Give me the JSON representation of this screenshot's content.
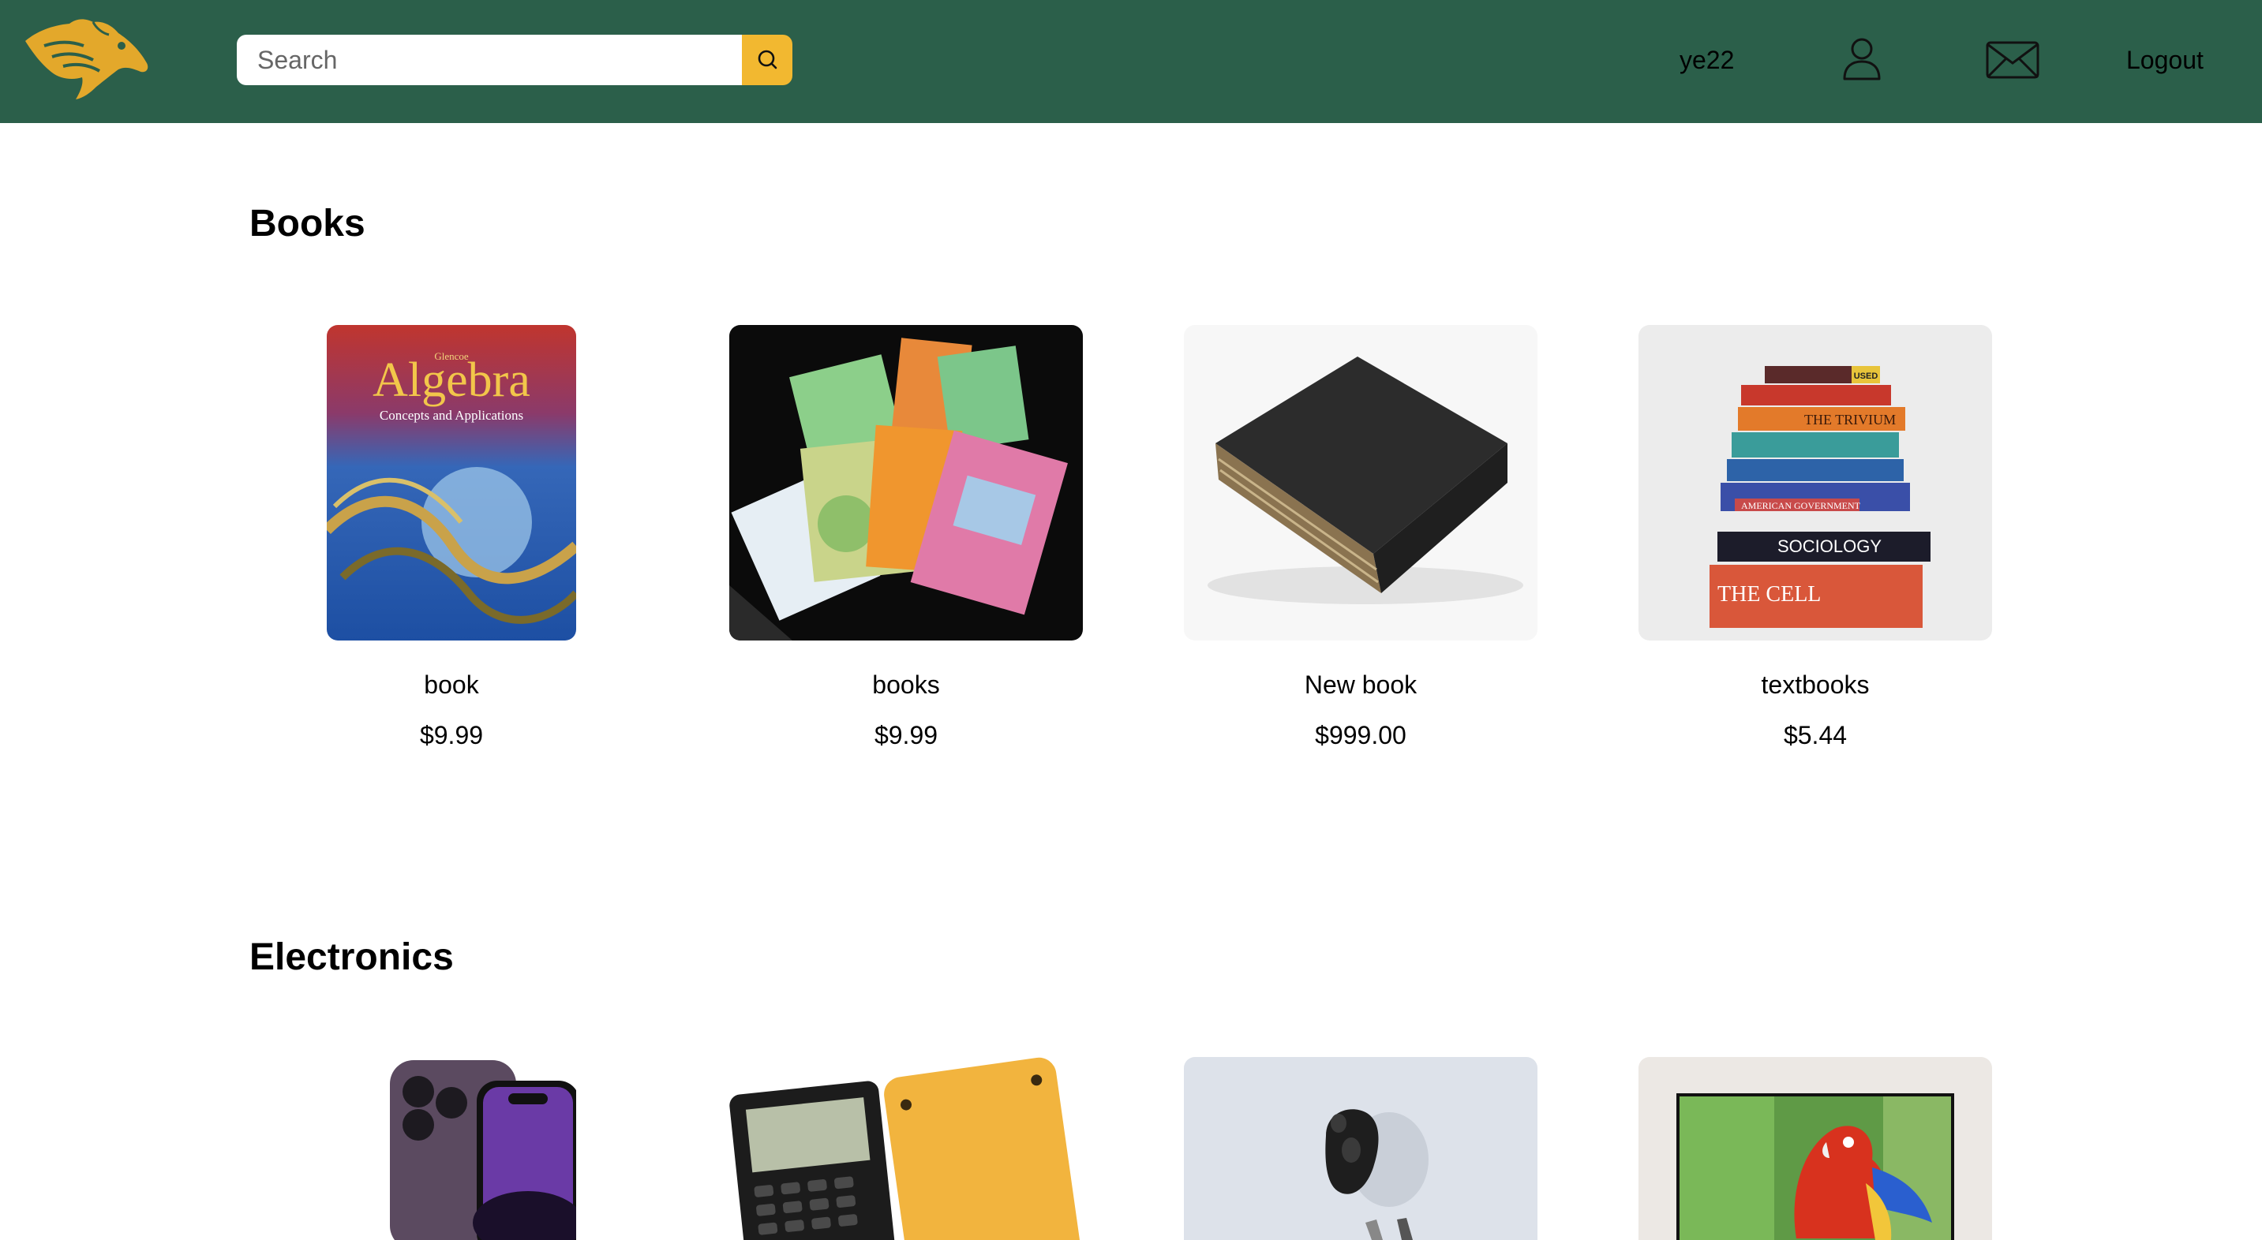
{
  "header": {
    "logo": "mustang-logo",
    "search": {
      "placeholder": "Search",
      "value": ""
    },
    "username": "ye22",
    "logout_label": "Logout",
    "colors": {
      "navbar": "#2b5f4a",
      "accent": "#f2b830"
    }
  },
  "sections": [
    {
      "title": "Books",
      "products": [
        {
          "name": "book",
          "price": "$9.99"
        },
        {
          "name": "books",
          "price": "$9.99"
        },
        {
          "name": "New book",
          "price": "$999.00"
        },
        {
          "name": "textbooks",
          "price": "$5.44"
        }
      ]
    },
    {
      "title": "Electronics",
      "products": [
        {
          "name": "",
          "price": ""
        },
        {
          "name": "",
          "price": ""
        },
        {
          "name": "",
          "price": ""
        },
        {
          "name": "",
          "price": ""
        }
      ]
    }
  ],
  "images": {
    "algebra_cover": {
      "publisher": "Glencoe",
      "title": "Algebra",
      "subtitle": "Concepts and Applications"
    },
    "textbook_spines": [
      "USED",
      "THE TRIVIUM",
      "AMERICAN GOVERNMENT",
      "SOCIOLOGY",
      "THE CELL"
    ]
  }
}
